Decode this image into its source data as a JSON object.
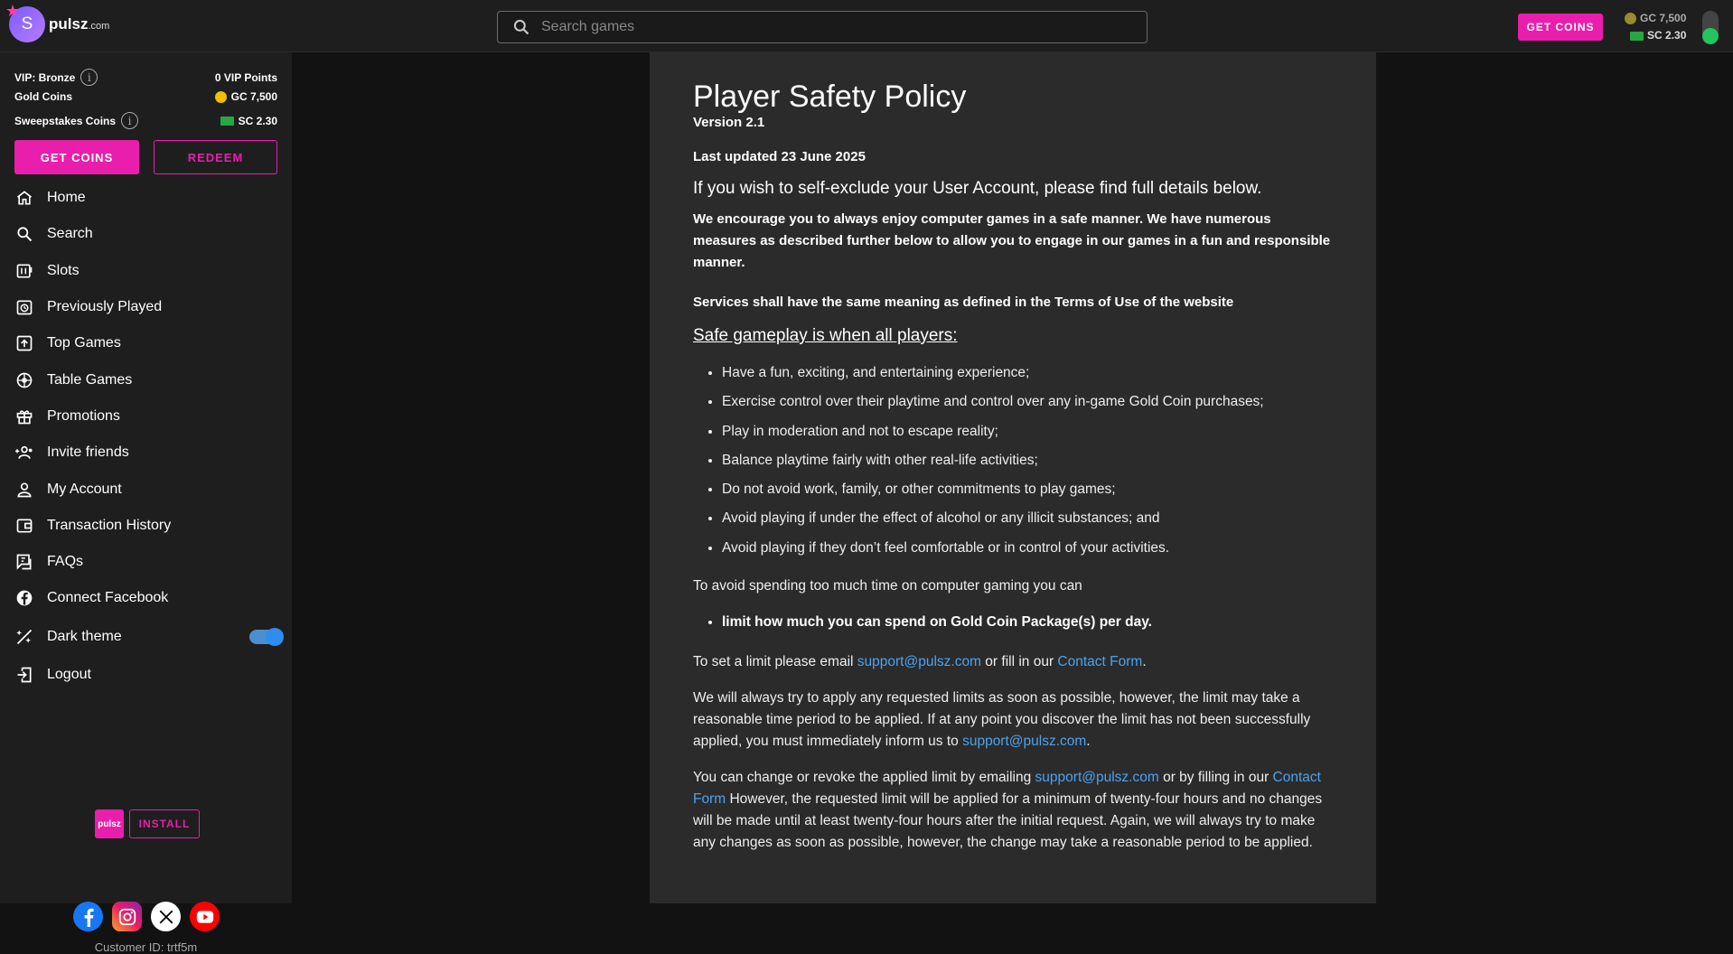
{
  "header": {
    "logo_initial": "S",
    "logo_name": "pulsz",
    "logo_tld": ".com",
    "search_placeholder": "Search games",
    "get_coins_label": "GET COINS",
    "gc_balance": "GC 7,500",
    "sc_balance": "SC 2.30"
  },
  "sidebar": {
    "vip_label": "VIP: Bronze",
    "vip_points": "0 VIP Points",
    "gold_label": "Gold Coins",
    "gold_value": "GC 7,500",
    "sweep_label": "Sweepstakes Coins",
    "sweep_value": "SC 2.30",
    "get_coins_label": "GET COINS",
    "redeem_label": "REDEEM",
    "nav": [
      {
        "label": "Home",
        "icon": "home-icon"
      },
      {
        "label": "Search",
        "icon": "search-icon"
      },
      {
        "label": "Slots",
        "icon": "slots-icon"
      },
      {
        "label": "Previously Played",
        "icon": "history-icon"
      },
      {
        "label": "Top Games",
        "icon": "top-games-icon"
      },
      {
        "label": "Table Games",
        "icon": "roulette-icon"
      },
      {
        "label": "Promotions",
        "icon": "gift-icon"
      },
      {
        "label": "Invite friends",
        "icon": "invite-friends-icon"
      },
      {
        "label": "My Account",
        "icon": "account-icon"
      },
      {
        "label": "Transaction History",
        "icon": "transactions-icon"
      },
      {
        "label": "FAQs",
        "icon": "faq-icon"
      },
      {
        "label": "Connect Facebook",
        "icon": "facebook-icon"
      },
      {
        "label": "Dark theme",
        "icon": "theme-icon"
      },
      {
        "label": "Logout",
        "icon": "logout-icon"
      }
    ],
    "dark_theme_on": true,
    "mini_logo": "pulsz",
    "install_label": "INSTALL",
    "customer_id": "Customer ID: trtf5m"
  },
  "content": {
    "title": "Player Safety Policy",
    "version": "Version 2.1",
    "updated": "Last updated 23 June 2025",
    "lead": "If you wish to self-exclude your User Account, please find full details below.",
    "intro": "We encourage you to always enjoy computer games in a safe manner. We have numerous measures as described further below to allow you to engage in our games in a fun and responsible manner.",
    "services_note": "Services shall have the same meaning as defined in the Terms of Use of the website",
    "safe_heading": "Safe gameplay is when all players:",
    "safe_list": [
      "Have a fun, exciting, and entertaining experience;",
      "Exercise control over their playtime and control over any in-game Gold Coin purchases;",
      "Play in moderation and not to escape reality;",
      "Balance playtime fairly with other real-life activities;",
      "Do not avoid work, family, or other commitments to play games;",
      "Avoid playing if under the effect of alcohol or any illicit substances; and",
      "Avoid playing if they don’t feel comfortable or in control of your activities."
    ],
    "avoid_text": "To avoid spending too much time on computer gaming you can",
    "limit_item": "limit how much you can spend on Gold Coin Package(s) per day.",
    "set_limit_prefix": "To set a limit please email ",
    "email": "support@pulsz.com",
    "set_limit_mid": " or fill in our ",
    "contact_form": "Contact Form",
    "period": ".",
    "apply_text": "We will always try to apply any requested limits as soon as possible, however, the limit may take a reasonable time period to be applied. If at any point you discover the limit has not been successfully applied, you must immediately inform us to ",
    "change_prefix": "You can change or revoke the applied limit by emailing ",
    "change_mid": " or by filling in our ",
    "change_rest": " However, the requested limit will be applied for a minimum of twenty-four hours and no changes will be made until at least twenty-four hours after the initial request. Again, we will always try to make any changes as soon as possible, however, the change may take a reasonable period to be applied."
  }
}
